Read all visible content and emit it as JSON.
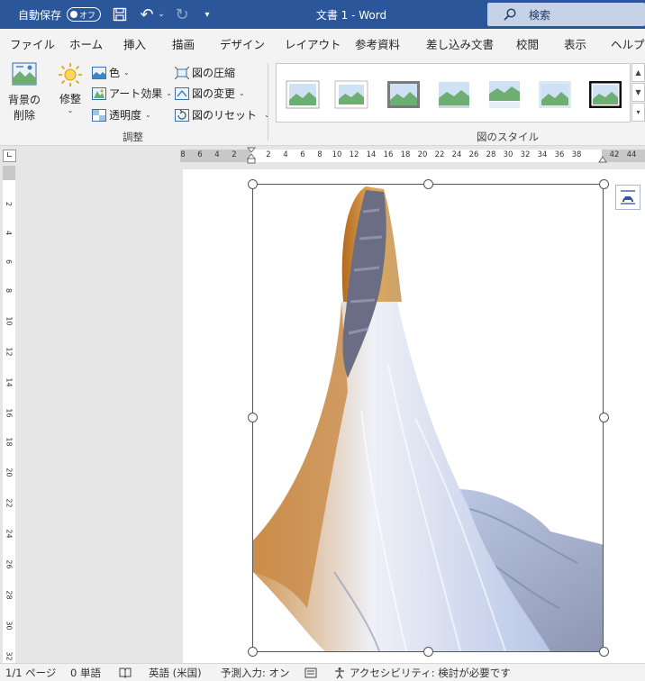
{
  "titlebar": {
    "autosave_label": "自動保存",
    "autosave_state": "オフ",
    "title": "文書 1  -  Word",
    "search_placeholder": "検索"
  },
  "tabs": [
    "ファイル",
    "ホーム",
    "挿入",
    "描画",
    "デザイン",
    "レイアウト",
    "参考資料",
    "差し込み文書",
    "校閲",
    "表示",
    "ヘルプ"
  ],
  "ribbon": {
    "remove_bg": {
      "line1": "背景の",
      "line2": "削除"
    },
    "adjust": {
      "corrections_label": "修整",
      "color_label": "色",
      "artistic_effects_label": "アート効果",
      "transparency_label": "透明度",
      "group_label": "調整"
    },
    "image_tools": {
      "compress_label": "図の圧縮",
      "change_label": "図の変更",
      "reset_label": "図のリセット"
    },
    "styles_group_label": "図のスタイル"
  },
  "ruler": {
    "h_numbers": [
      "8",
      "6",
      "4",
      "2",
      "2",
      "4",
      "6",
      "8",
      "10",
      "12",
      "14",
      "16",
      "18",
      "20",
      "22",
      "24",
      "26",
      "28",
      "30",
      "32",
      "34",
      "36",
      "38",
      "42",
      "44"
    ],
    "v_numbers": [
      "2",
      "4",
      "6",
      "8",
      "10",
      "12",
      "14",
      "16",
      "18",
      "20",
      "22",
      "24",
      "26",
      "28",
      "30",
      "32"
    ]
  },
  "statusbar": {
    "page": "1/1 ページ",
    "words": "0 単語",
    "language": "英語 (米国)",
    "predictive": "予測入力: オン",
    "accessibility": "アクセシビリティ: 検討が必要です"
  },
  "colors": {
    "titlebar": "#2b579a",
    "ribbon": "#f3f3f3",
    "search": "#c6d3e7"
  },
  "icons": {
    "save": "save-icon",
    "undo": "undo-icon",
    "redo": "redo-icon",
    "search": "search-icon"
  }
}
